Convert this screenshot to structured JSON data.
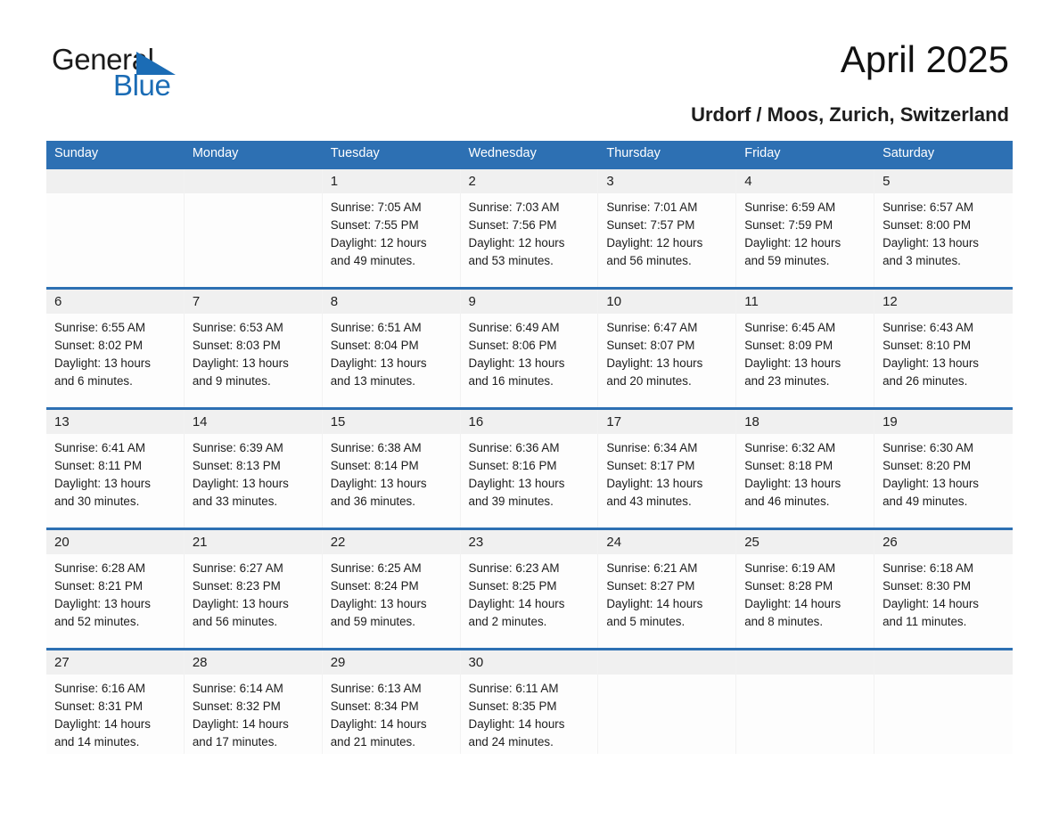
{
  "brand": {
    "name_part1": "General",
    "name_part2": "Blue",
    "accent_color": "#1b6cb5",
    "header_blue": "#2d70b3"
  },
  "header": {
    "title": "April 2025",
    "subtitle": "Urdorf / Moos, Zurich, Switzerland"
  },
  "calendar": {
    "day_headers": [
      "Sunday",
      "Monday",
      "Tuesday",
      "Wednesday",
      "Thursday",
      "Friday",
      "Saturday"
    ],
    "weeks": [
      [
        {
          "day": "",
          "text": ""
        },
        {
          "day": "",
          "text": ""
        },
        {
          "day": "1",
          "text": "Sunrise: 7:05 AM\nSunset: 7:55 PM\nDaylight: 12 hours\nand 49 minutes."
        },
        {
          "day": "2",
          "text": "Sunrise: 7:03 AM\nSunset: 7:56 PM\nDaylight: 12 hours\nand 53 minutes."
        },
        {
          "day": "3",
          "text": "Sunrise: 7:01 AM\nSunset: 7:57 PM\nDaylight: 12 hours\nand 56 minutes."
        },
        {
          "day": "4",
          "text": "Sunrise: 6:59 AM\nSunset: 7:59 PM\nDaylight: 12 hours\nand 59 minutes."
        },
        {
          "day": "5",
          "text": "Sunrise: 6:57 AM\nSunset: 8:00 PM\nDaylight: 13 hours\nand 3 minutes."
        }
      ],
      [
        {
          "day": "6",
          "text": "Sunrise: 6:55 AM\nSunset: 8:02 PM\nDaylight: 13 hours\nand 6 minutes."
        },
        {
          "day": "7",
          "text": "Sunrise: 6:53 AM\nSunset: 8:03 PM\nDaylight: 13 hours\nand 9 minutes."
        },
        {
          "day": "8",
          "text": "Sunrise: 6:51 AM\nSunset: 8:04 PM\nDaylight: 13 hours\nand 13 minutes."
        },
        {
          "day": "9",
          "text": "Sunrise: 6:49 AM\nSunset: 8:06 PM\nDaylight: 13 hours\nand 16 minutes."
        },
        {
          "day": "10",
          "text": "Sunrise: 6:47 AM\nSunset: 8:07 PM\nDaylight: 13 hours\nand 20 minutes."
        },
        {
          "day": "11",
          "text": "Sunrise: 6:45 AM\nSunset: 8:09 PM\nDaylight: 13 hours\nand 23 minutes."
        },
        {
          "day": "12",
          "text": "Sunrise: 6:43 AM\nSunset: 8:10 PM\nDaylight: 13 hours\nand 26 minutes."
        }
      ],
      [
        {
          "day": "13",
          "text": "Sunrise: 6:41 AM\nSunset: 8:11 PM\nDaylight: 13 hours\nand 30 minutes."
        },
        {
          "day": "14",
          "text": "Sunrise: 6:39 AM\nSunset: 8:13 PM\nDaylight: 13 hours\nand 33 minutes."
        },
        {
          "day": "15",
          "text": "Sunrise: 6:38 AM\nSunset: 8:14 PM\nDaylight: 13 hours\nand 36 minutes."
        },
        {
          "day": "16",
          "text": "Sunrise: 6:36 AM\nSunset: 8:16 PM\nDaylight: 13 hours\nand 39 minutes."
        },
        {
          "day": "17",
          "text": "Sunrise: 6:34 AM\nSunset: 8:17 PM\nDaylight: 13 hours\nand 43 minutes."
        },
        {
          "day": "18",
          "text": "Sunrise: 6:32 AM\nSunset: 8:18 PM\nDaylight: 13 hours\nand 46 minutes."
        },
        {
          "day": "19",
          "text": "Sunrise: 6:30 AM\nSunset: 8:20 PM\nDaylight: 13 hours\nand 49 minutes."
        }
      ],
      [
        {
          "day": "20",
          "text": "Sunrise: 6:28 AM\nSunset: 8:21 PM\nDaylight: 13 hours\nand 52 minutes."
        },
        {
          "day": "21",
          "text": "Sunrise: 6:27 AM\nSunset: 8:23 PM\nDaylight: 13 hours\nand 56 minutes."
        },
        {
          "day": "22",
          "text": "Sunrise: 6:25 AM\nSunset: 8:24 PM\nDaylight: 13 hours\nand 59 minutes."
        },
        {
          "day": "23",
          "text": "Sunrise: 6:23 AM\nSunset: 8:25 PM\nDaylight: 14 hours\nand 2 minutes."
        },
        {
          "day": "24",
          "text": "Sunrise: 6:21 AM\nSunset: 8:27 PM\nDaylight: 14 hours\nand 5 minutes."
        },
        {
          "day": "25",
          "text": "Sunrise: 6:19 AM\nSunset: 8:28 PM\nDaylight: 14 hours\nand 8 minutes."
        },
        {
          "day": "26",
          "text": "Sunrise: 6:18 AM\nSunset: 8:30 PM\nDaylight: 14 hours\nand 11 minutes."
        }
      ],
      [
        {
          "day": "27",
          "text": "Sunrise: 6:16 AM\nSunset: 8:31 PM\nDaylight: 14 hours\nand 14 minutes."
        },
        {
          "day": "28",
          "text": "Sunrise: 6:14 AM\nSunset: 8:32 PM\nDaylight: 14 hours\nand 17 minutes."
        },
        {
          "day": "29",
          "text": "Sunrise: 6:13 AM\nSunset: 8:34 PM\nDaylight: 14 hours\nand 21 minutes."
        },
        {
          "day": "30",
          "text": "Sunrise: 6:11 AM\nSunset: 8:35 PM\nDaylight: 14 hours\nand 24 minutes."
        },
        {
          "day": "",
          "text": ""
        },
        {
          "day": "",
          "text": ""
        },
        {
          "day": "",
          "text": ""
        }
      ]
    ]
  }
}
